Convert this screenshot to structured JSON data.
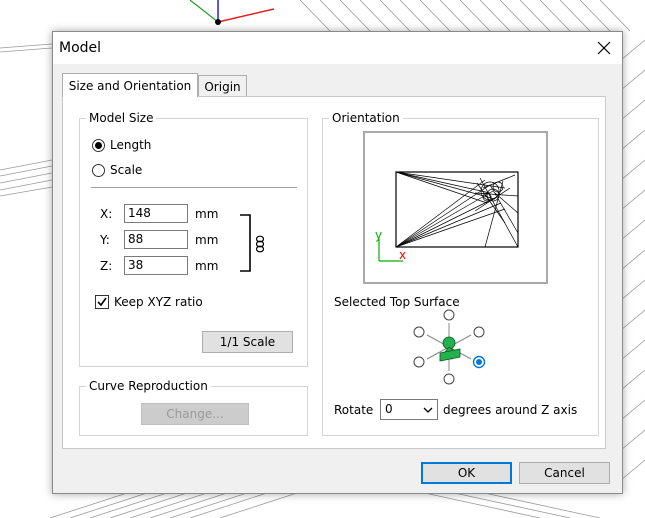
{
  "dialog": {
    "title": "Model",
    "tabs": [
      {
        "label": "Size and Orientation",
        "active": true
      },
      {
        "label": "Origin",
        "active": false
      }
    ]
  },
  "model_size": {
    "group_label": "Model Size",
    "mode_options": [
      {
        "label": "Length",
        "selected": true
      },
      {
        "label": "Scale",
        "selected": false
      }
    ],
    "fields": [
      {
        "axis": "X:",
        "value": "148",
        "unit": "mm"
      },
      {
        "axis": "Y:",
        "value": "88",
        "unit": "mm"
      },
      {
        "axis": "Z:",
        "value": "38",
        "unit": "mm"
      }
    ],
    "keep_ratio": {
      "label": "Keep XYZ ratio",
      "checked": true
    },
    "scale_button": "1/1 Scale"
  },
  "curve": {
    "group_label": "Curve Reproduction",
    "change_button": "Change..."
  },
  "orientation": {
    "group_label": "Orientation",
    "axis_y": "y",
    "axis_x": "x",
    "top_surface_label": "Selected Top Surface",
    "rotate_label": "Rotate",
    "rotate_value": "0",
    "rotate_suffix": "degrees around Z axis"
  },
  "footer": {
    "ok": "OK",
    "cancel": "Cancel"
  },
  "colors": {
    "accent": "#0078d7",
    "model_green": "#22b14c",
    "axis_red": "#ff0000",
    "axis_green": "#00b000"
  }
}
